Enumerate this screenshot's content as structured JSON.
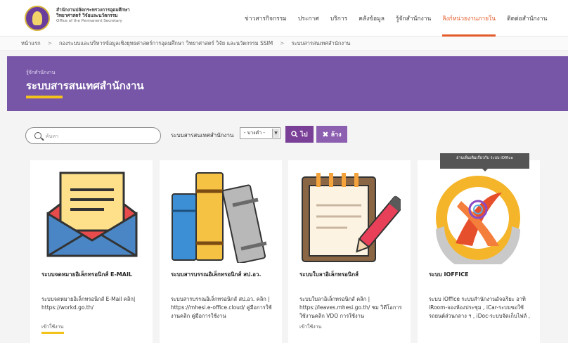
{
  "header": {
    "org_line1": "สำนักงานปลัดกระทรวงการอุดมศึกษา",
    "org_line2": "วิทยาศาสตร์ วิจัยและนวัตกรรม",
    "org_line3": "Office of the Permanent Secretary",
    "nav": [
      {
        "label": "ข่าวสารกิจกรรม",
        "active": false
      },
      {
        "label": "ประกาศ",
        "active": false
      },
      {
        "label": "บริการ",
        "active": false
      },
      {
        "label": "คลังข้อมูล",
        "active": false
      },
      {
        "label": "รู้จักสำนักงาน",
        "active": false
      },
      {
        "label": "ลิงก์หน่วยงานภายใน",
        "active": true
      },
      {
        "label": "ติดต่อสำนักงาน",
        "active": false
      }
    ],
    "accent": "#e35b2a"
  },
  "breadcrumb": [
    "หน้าแรก",
    "กองระบบและบริหารข้อมูลเชิงยุทธศาสตร์การอุดมศึกษา วิทยาศาสตร์ วิจัย และนวัตกรรม SSIM",
    "ระบบสารสนเทศสำนักงาน"
  ],
  "banner": {
    "kicker": "รู้จักสำนักงาน",
    "title": "ระบบสารสนเทศสำนักงาน",
    "bg": "#7756a7"
  },
  "search": {
    "placeholder": "ค้นหา",
    "value": "",
    "filter_label": "ระบบสารสนเทศสำนักงาน",
    "select_value": "- บางคำ -",
    "go_label": "ไป",
    "clear_label": "ล้าง"
  },
  "tooltip": "อ่านเพิ่มเติมเกี่ยวกับ ระบบ iOffice",
  "cards": [
    {
      "title": "ระบบจดหมายอิเล็กทรอนิกส์ E-MAIL",
      "desc": "ระบบจดหมายอิเล็กทรอนิกส์ E-Mail คลิก| https://workd.go.th/",
      "more": "เข้าใช้งาน",
      "icon": "envelope-icon"
    },
    {
      "title": "ระบบสารบรรณอิเล็กทรอนิกส์ สป.อว.",
      "desc": "ระบบสารบรรณอิเล็กทรอนิกส์ สป.อว. คลิก | https://mhesi.e-office.cloud/ คู่มือการใช้งานคลิก คู่มือการใช้งาน",
      "more": "",
      "icon": "books-icon"
    },
    {
      "title": "ระบบใบลาอิเล็กทรอนิกส์",
      "desc": "ระบบใบลาอิเล็กทรอนิกส์ คลิก | https://leaves.mhesi.go.th/ ชม วิดีโอการใช้งานคลิก VDO การใช้งาน",
      "more": "เข้าใช้งาน",
      "icon": "notepad-pen-icon"
    },
    {
      "title": "ระบบ IOFFICE",
      "desc": "ระบบ iOffice ระบบสำนักงานอัจฉริยะ อาทิ iRoom-จองห้องประชุม , iCar-ระบบขอใช้รถยนต์ส่วนกลาง ฯ , iDoc-ระบบจัดเก็บไฟล์ ,",
      "more": "",
      "icon": "ioffice-logo-icon"
    }
  ]
}
